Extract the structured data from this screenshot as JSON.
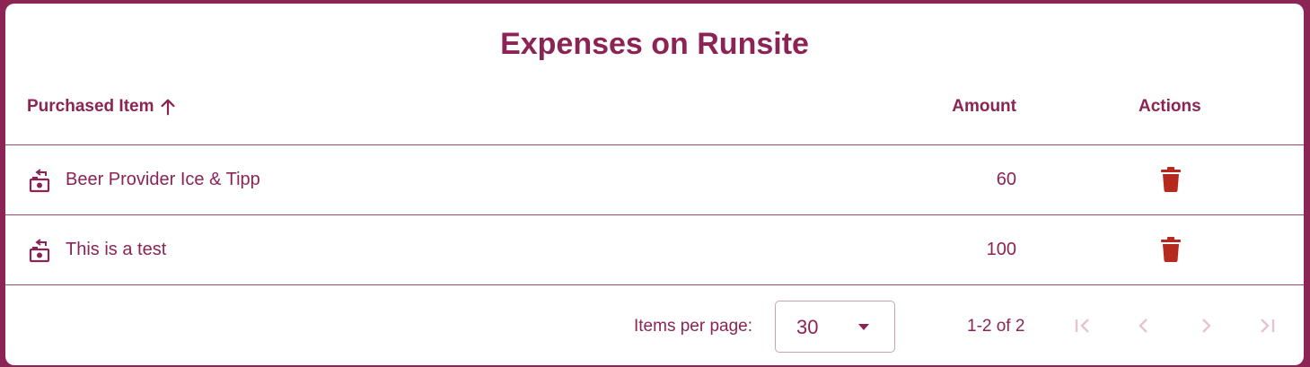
{
  "title": "Expenses on Runsite",
  "columns": {
    "item": "Purchased Item",
    "amount": "Amount",
    "actions": "Actions"
  },
  "rows": [
    {
      "name": "Beer Provider Ice & Tipp",
      "amount": "60"
    },
    {
      "name": "This is a test",
      "amount": "100"
    }
  ],
  "paginator": {
    "items_per_page_label": "Items per page:",
    "page_size": "30",
    "range_label": "1-2 of 2"
  },
  "icons": {
    "sort": "arrow-up-icon",
    "row": "payments-icon",
    "delete": "trash-icon",
    "dropdown": "caret-down-icon",
    "first": "first-page-icon",
    "prev": "chevron-left-icon",
    "next": "chevron-right-icon",
    "last": "last-page-icon"
  },
  "colors": {
    "primary": "#8b2454",
    "border": "#8a2555",
    "delete": "#b5291f",
    "disabled": "#e5c3d2"
  }
}
